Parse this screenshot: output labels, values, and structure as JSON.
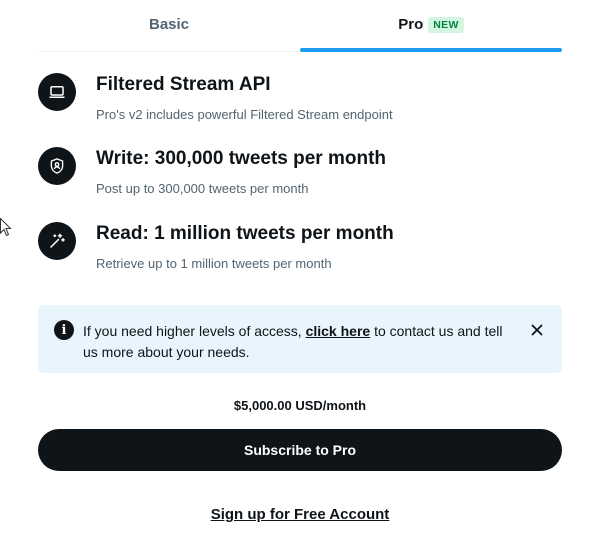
{
  "tabs": {
    "basic": "Basic",
    "pro": "Pro",
    "pro_badge": "NEW",
    "active": "pro"
  },
  "features": [
    {
      "icon": "laptop-icon",
      "title": "Filtered Stream API",
      "desc": "Pro's v2 includes powerful Filtered Stream endpoint"
    },
    {
      "icon": "shield-person-icon",
      "title": "Write: 300,000 tweets per month",
      "desc": "Post up to 300,000 tweets per month"
    },
    {
      "icon": "magic-wand-icon",
      "title": "Read: 1 million tweets per month",
      "desc": "Retrieve up to 1 million tweets per month"
    }
  ],
  "notice": {
    "before": "If you need higher levels of access, ",
    "link": "click here",
    "after": " to contact us and tell us more about your needs."
  },
  "price": "$5,000.00 USD/month",
  "subscribe_label": "Subscribe to Pro",
  "signup_label": "Sign up for Free Account",
  "colors": {
    "accent": "#1d9bf0",
    "dark": "#0f1419",
    "muted": "#536471",
    "notice_bg": "#e8f5fd",
    "badge_bg": "#d3f5e1",
    "badge_text": "#00853f"
  }
}
